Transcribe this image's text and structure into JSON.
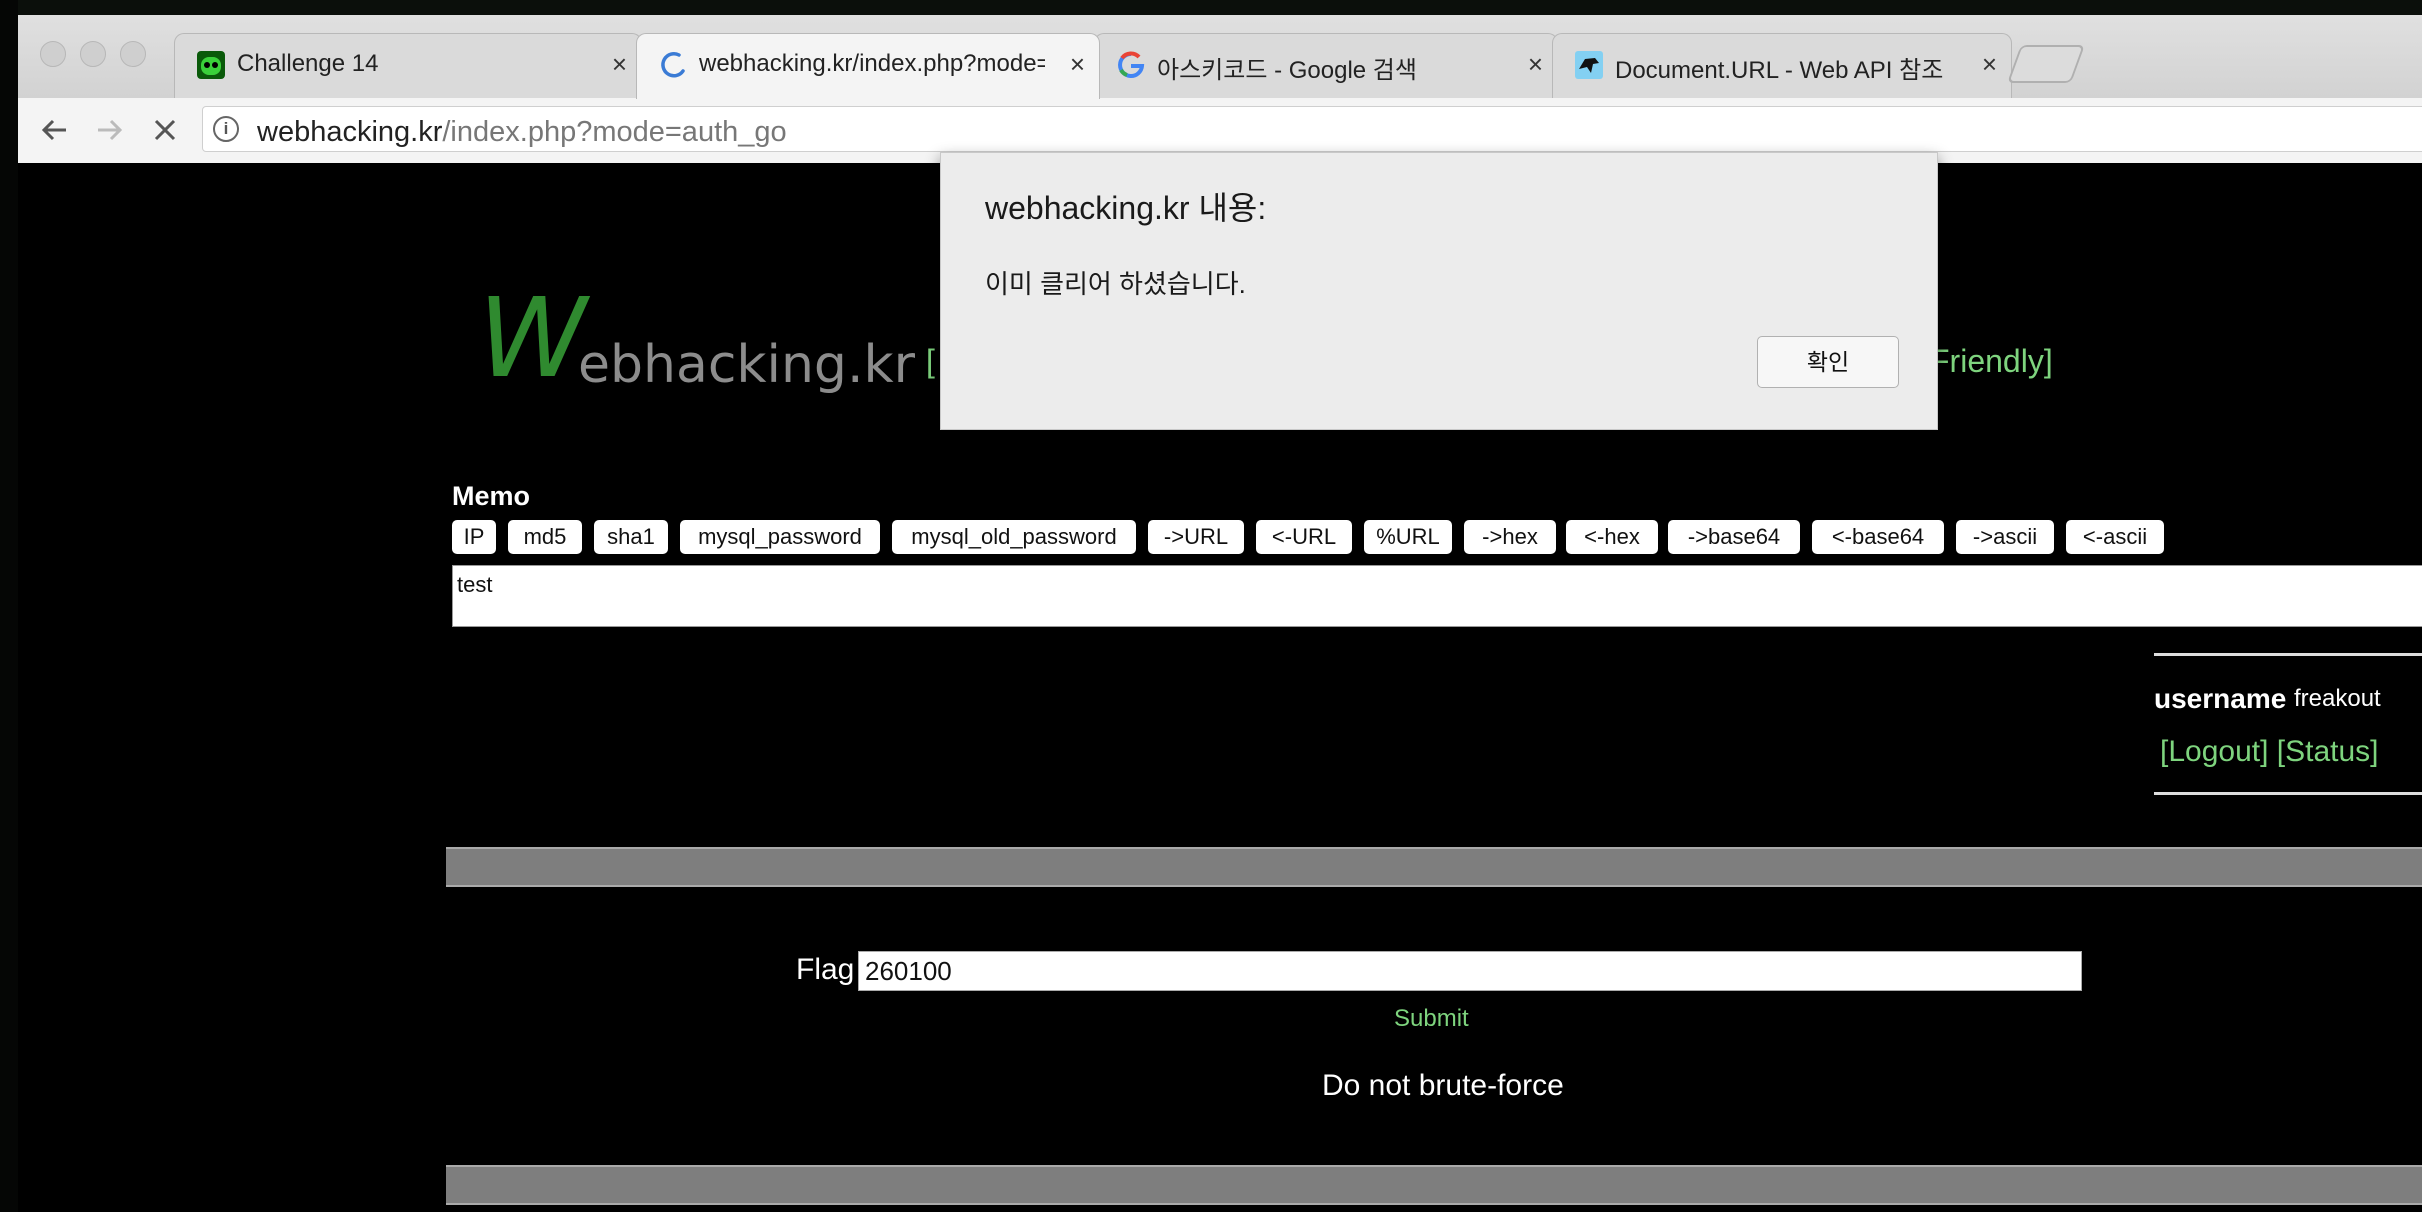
{
  "browser": {
    "tabs": [
      {
        "title": "Challenge 14",
        "icon": "robot-favicon-icon"
      },
      {
        "title": "webhacking.kr/index.php?mode=auth_go",
        "icon": "loading-spinner-icon"
      },
      {
        "title": "아스키코드 - Google 검색",
        "icon": "google-g-icon"
      },
      {
        "title": "Document.URL - Web API 참조",
        "icon": "mdn-dino-icon"
      }
    ],
    "close_glyph": "×",
    "address": {
      "host": "webhacking.kr",
      "path": "/index.php?mode=auth_go"
    }
  },
  "site": {
    "logo_initial": "W",
    "logo_rest": "ebhacking.kr",
    "menu_left": "[",
    "menu_right": "Friendly]"
  },
  "memo": {
    "label": "Memo",
    "buttons": [
      "IP",
      "md5",
      "sha1",
      "mysql_password",
      "mysql_old_password",
      "->URL",
      "<-URL",
      "%URL",
      "->hex",
      "<-hex",
      "->base64",
      "<-base64",
      "->ascii",
      "<-ascii"
    ],
    "text": "test"
  },
  "user": {
    "label": "username",
    "value": "freakout",
    "logout": "[Logout]",
    "status": "[Status]"
  },
  "flag": {
    "label": "Flag",
    "value": "260100",
    "submit": "Submit",
    "notice": "Do not brute-force"
  },
  "dialog": {
    "title": "webhacking.kr 내용:",
    "message": "이미 클리어 하셨습니다.",
    "ok": "확인"
  }
}
